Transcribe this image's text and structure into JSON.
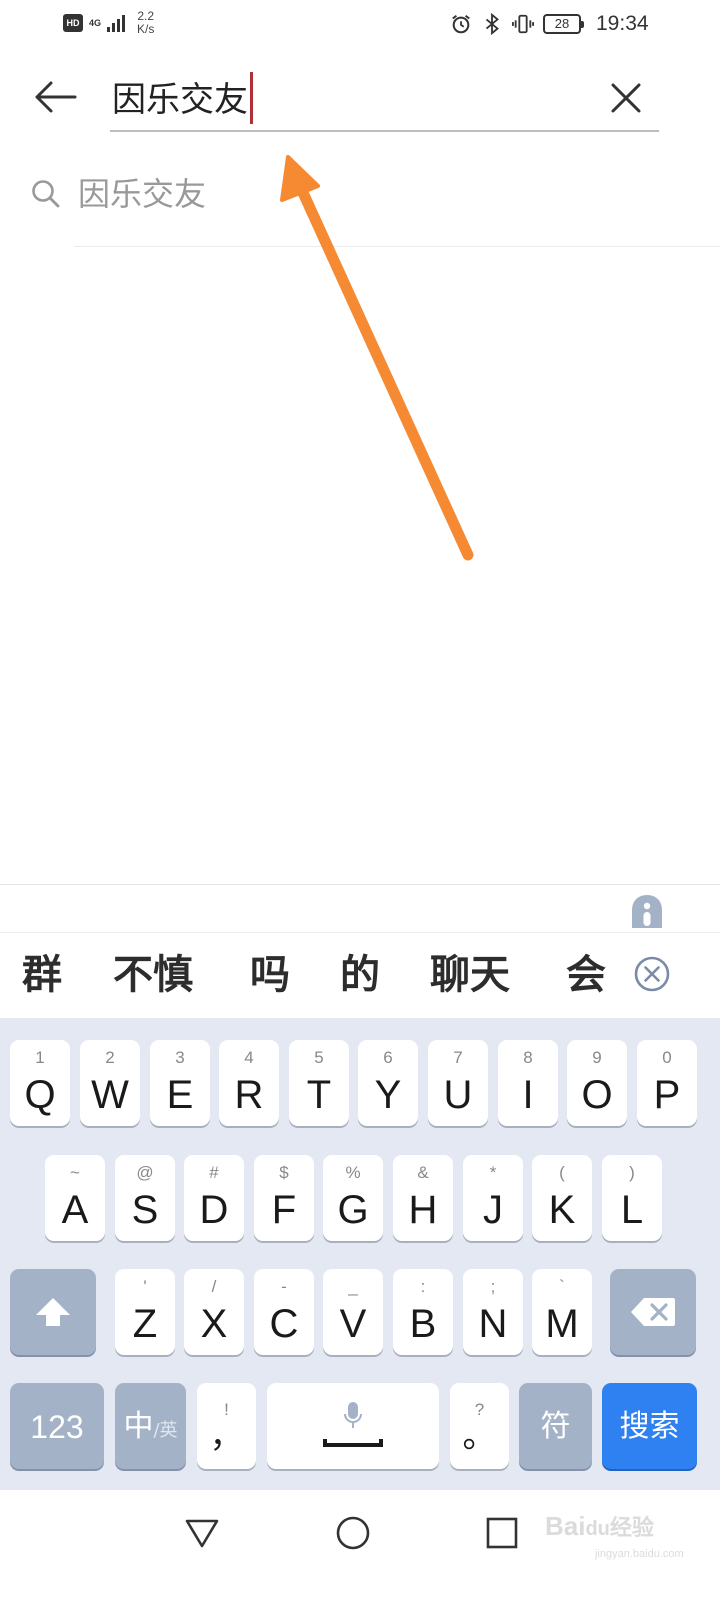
{
  "status_bar": {
    "hd": "HD",
    "network": "4G",
    "speed_value": "2.2",
    "speed_unit": "K/s",
    "battery": "28",
    "time": "19:34",
    "icons": [
      "alarm-icon",
      "bluetooth-icon",
      "vibrate-icon"
    ]
  },
  "search": {
    "value": "因乐交友",
    "back_icon": "arrow-left-icon",
    "clear_icon": "close-icon"
  },
  "suggestion": {
    "text": "因乐交友",
    "icon": "search-icon"
  },
  "annotation": {
    "color": "#f58a32"
  },
  "keyboard": {
    "candidates": [
      "群",
      "不慎",
      "吗",
      "的",
      "聊天",
      "会"
    ],
    "row1": [
      {
        "main": "Q",
        "sub": "1"
      },
      {
        "main": "W",
        "sub": "2"
      },
      {
        "main": "E",
        "sub": "3"
      },
      {
        "main": "R",
        "sub": "4"
      },
      {
        "main": "T",
        "sub": "5"
      },
      {
        "main": "Y",
        "sub": "6"
      },
      {
        "main": "U",
        "sub": "7"
      },
      {
        "main": "I",
        "sub": "8"
      },
      {
        "main": "O",
        "sub": "9"
      },
      {
        "main": "P",
        "sub": "0"
      }
    ],
    "row2": [
      {
        "main": "A",
        "sub": "~"
      },
      {
        "main": "S",
        "sub": "@"
      },
      {
        "main": "D",
        "sub": "#"
      },
      {
        "main": "F",
        "sub": "$"
      },
      {
        "main": "G",
        "sub": "%"
      },
      {
        "main": "H",
        "sub": "&"
      },
      {
        "main": "J",
        "sub": "*"
      },
      {
        "main": "K",
        "sub": "("
      },
      {
        "main": "L",
        "sub": ")"
      }
    ],
    "row3": [
      {
        "main": "Z",
        "sub": "'"
      },
      {
        "main": "X",
        "sub": "/"
      },
      {
        "main": "C",
        "sub": "-"
      },
      {
        "main": "V",
        "sub": "_"
      },
      {
        "main": "B",
        "sub": ":"
      },
      {
        "main": "N",
        "sub": ";"
      },
      {
        "main": "M",
        "sub": "`"
      }
    ],
    "numbers_label": "123",
    "lang_main": "中",
    "lang_sub": "/英",
    "comma": {
      "main": "，",
      "sub": "!"
    },
    "period": {
      "main": "。",
      "sub": "?"
    },
    "symbol_label": "符",
    "search_label": "搜索",
    "accent_color": "#2f80f0"
  },
  "watermark": {
    "brand": "Bai",
    "suffix": "经验",
    "domain": "jingyan.baidu.com"
  }
}
